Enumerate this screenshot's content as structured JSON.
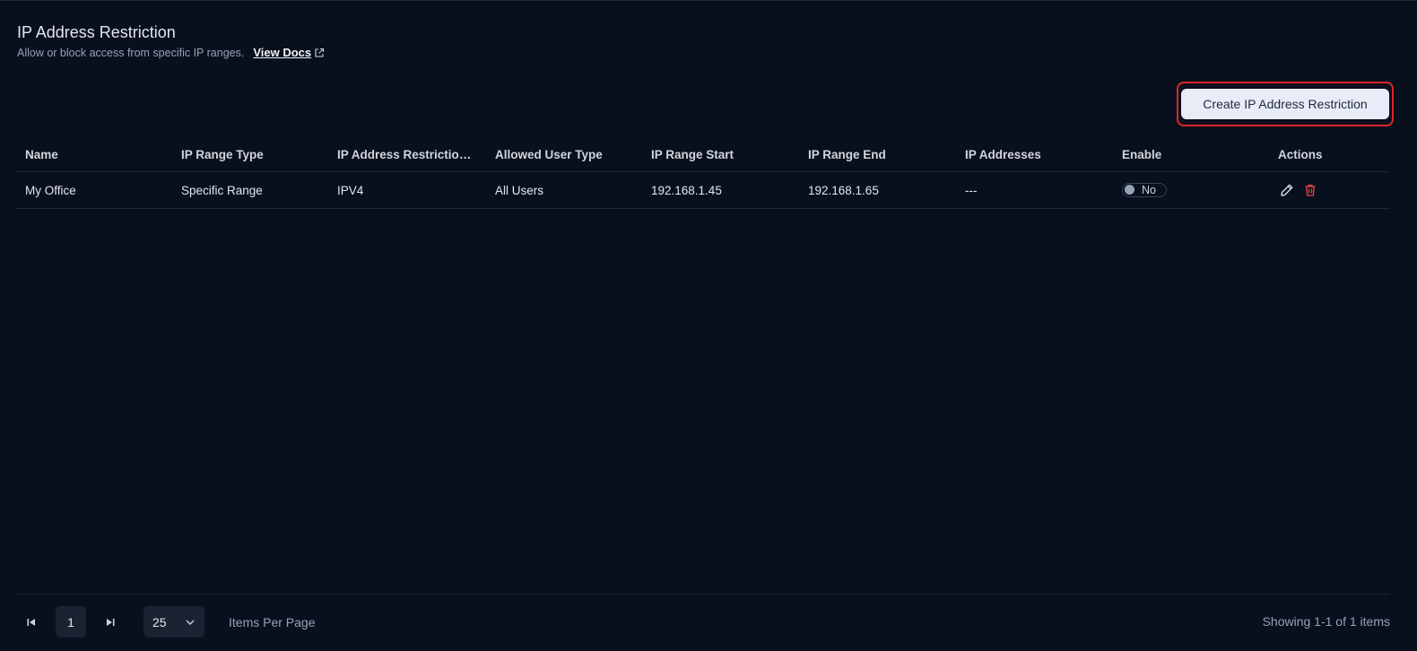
{
  "header": {
    "title": "IP Address Restriction",
    "subtitle": "Allow or block access from specific IP ranges.",
    "docs_link": "View Docs"
  },
  "toolbar": {
    "create_label": "Create IP Address Restriction"
  },
  "table": {
    "columns": [
      "Name",
      "IP Range Type",
      "IP Address Restriction ...",
      "Allowed User Type",
      "IP Range Start",
      "IP Range End",
      "IP Addresses",
      "Enable",
      "Actions"
    ],
    "rows": [
      {
        "name": "My Office",
        "ip_range_type": "Specific Range",
        "restriction_type": "IPV4",
        "allowed_user_type": "All Users",
        "range_start": "192.168.1.45",
        "range_end": "192.168.1.65",
        "ip_addresses": "---",
        "enable": "No",
        "actions": [
          "edit-icon",
          "trash-icon"
        ]
      }
    ]
  },
  "pagination": {
    "current_page": "1",
    "per_page": "25",
    "per_page_label": "Items Per Page",
    "showing": "Showing 1-1 of 1 items"
  },
  "colors": {
    "background": "#080f1d",
    "highlight_border": "#dc2626",
    "delete_icon": "#ef4444"
  }
}
